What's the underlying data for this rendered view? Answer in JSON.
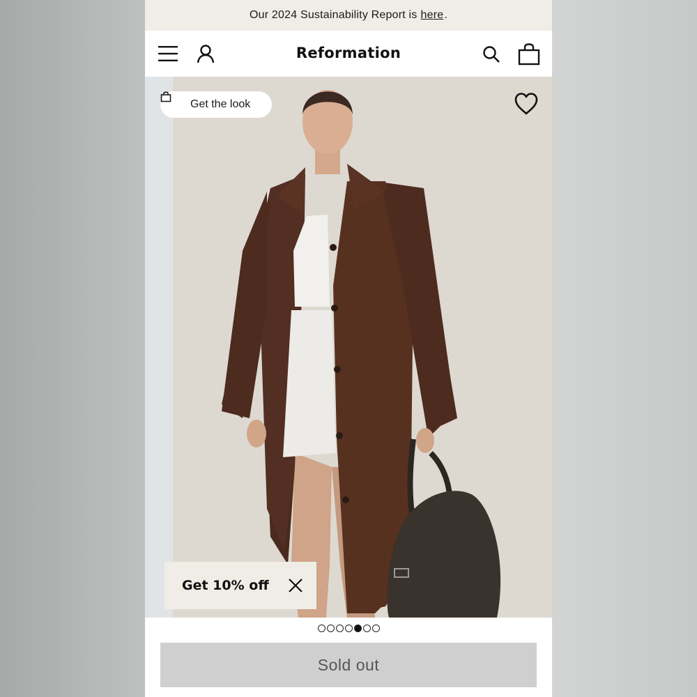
{
  "announcement": {
    "text": "Our 2024 Sustainability Report is",
    "link_label": "here",
    "suffix": "."
  },
  "header": {
    "brand": "Reformation",
    "icons": [
      "menu-icon",
      "account-icon",
      "search-icon",
      "bag-icon"
    ]
  },
  "product": {
    "get_the_look_label": "Get the look",
    "promo_label": "Get 10% off",
    "gallery": {
      "total_images": 7,
      "active_index": 5
    },
    "cta_label": "Sold out"
  },
  "colors": {
    "announcement_bg": "#efede6",
    "coat": "#4e2b20",
    "cta_bg": "#cfcfcf",
    "cta_text": "#555555"
  }
}
